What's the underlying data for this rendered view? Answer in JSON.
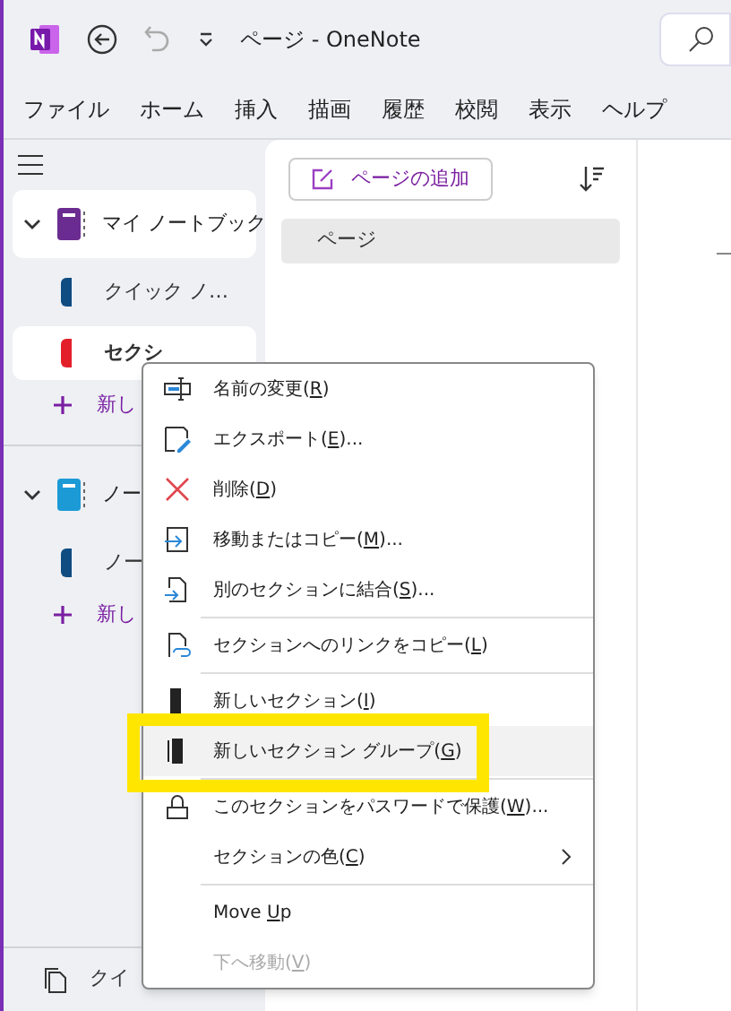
{
  "window": {
    "title": "ページ - OneNote"
  },
  "menu_bar": [
    {
      "label": "ファイル"
    },
    {
      "label": "ホーム"
    },
    {
      "label": "挿入"
    },
    {
      "label": "描画"
    },
    {
      "label": "履歴"
    },
    {
      "label": "校閲"
    },
    {
      "label": "表示"
    },
    {
      "label": "ヘルプ"
    }
  ],
  "sidebar": {
    "notebooks": [
      {
        "name": "マイ ノートブック",
        "color": "#6b2c91",
        "expanded": true,
        "selected": true,
        "sections": [
          {
            "name": "クイック ノ…",
            "color": "#0f4c81",
            "selected": false
          },
          {
            "name": "セクシ",
            "color": "#e3202a",
            "selected": true
          }
        ],
        "new_section": "新し"
      },
      {
        "name": "ノー",
        "color": "#1b9ad6",
        "expanded": true,
        "selected": false,
        "sections": [
          {
            "name": "ノー",
            "color": "#0f4c81",
            "selected": false
          }
        ],
        "new_section": "新し"
      }
    ],
    "footer": "クイ"
  },
  "pages": {
    "add_button": "ページの追加",
    "items": [
      {
        "title": "ページ",
        "selected": true
      }
    ]
  },
  "context_menu": {
    "items": [
      {
        "kind": "item",
        "before": "名前の変更(",
        "key": "R",
        "after": ")",
        "disabled": false,
        "highlighted": false,
        "submenu": false,
        "annotated": false
      },
      {
        "kind": "item",
        "before": "エクスポート(",
        "key": "E",
        "after": ")...",
        "disabled": false,
        "highlighted": false,
        "submenu": false,
        "annotated": false
      },
      {
        "kind": "item",
        "before": "削除(",
        "key": "D",
        "after": ")",
        "disabled": false,
        "highlighted": false,
        "submenu": false,
        "annotated": false
      },
      {
        "kind": "item",
        "before": "移動またはコピー(",
        "key": "M",
        "after": ")...",
        "disabled": false,
        "highlighted": false,
        "submenu": false,
        "annotated": false
      },
      {
        "kind": "item",
        "before": "別のセクションに結合(",
        "key": "S",
        "after": ")...",
        "disabled": false,
        "highlighted": false,
        "submenu": false,
        "annotated": false
      },
      {
        "kind": "separator"
      },
      {
        "kind": "item",
        "before": "セクションへのリンクをコピー(",
        "key": "L",
        "after": ")",
        "disabled": false,
        "highlighted": false,
        "submenu": false,
        "annotated": false
      },
      {
        "kind": "separator"
      },
      {
        "kind": "item",
        "before": "新しいセクション(",
        "key": "I",
        "after": ")",
        "disabled": false,
        "highlighted": false,
        "submenu": false,
        "annotated": false
      },
      {
        "kind": "item",
        "before": "新しいセクション グループ(",
        "key": "G",
        "after": ")",
        "disabled": false,
        "highlighted": true,
        "submenu": false,
        "annotated": true
      },
      {
        "kind": "separator"
      },
      {
        "kind": "item",
        "before": "このセクションをパスワードで保護(",
        "key": "W",
        "after": ")...",
        "disabled": false,
        "highlighted": false,
        "submenu": false,
        "annotated": false
      },
      {
        "kind": "item",
        "before": "セクションの色(",
        "key": "C",
        "after": ")",
        "disabled": false,
        "highlighted": false,
        "submenu": true,
        "annotated": false
      },
      {
        "kind": "separator"
      },
      {
        "kind": "item",
        "before": "Move ",
        "key": "U",
        "after": "p",
        "disabled": false,
        "highlighted": false,
        "submenu": false,
        "annotated": false
      },
      {
        "kind": "item",
        "before": "下へ移動(",
        "key": "V",
        "after": ")",
        "disabled": true,
        "highlighted": false,
        "submenu": false,
        "annotated": false
      }
    ]
  }
}
